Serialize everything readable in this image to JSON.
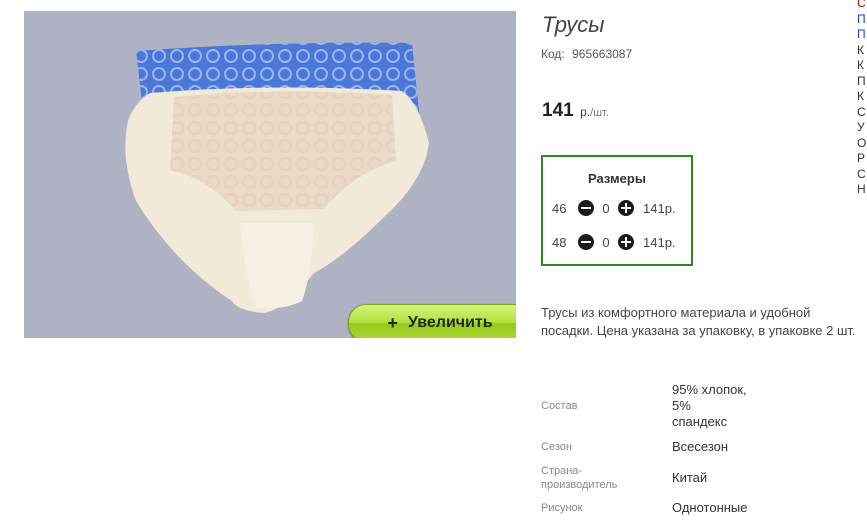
{
  "product": {
    "title": "Трусы",
    "code_label": "Код:",
    "code": "965663087",
    "price": "141",
    "currency": "р.",
    "per_unit": "/шт.",
    "zoom_button": "Увеличить",
    "zoom_icon": "plus-icon",
    "sizes_title": "Размеры",
    "sizes": [
      {
        "size": "46",
        "qty": "0",
        "price": "141р."
      },
      {
        "size": "48",
        "qty": "0",
        "price": "141р."
      }
    ],
    "description": "Трусы из комфортного материала и удобной посадки. Цена указана за упаковку, в упаковке 2 шт.",
    "attributes": [
      {
        "key": "Состав",
        "value": "95% хлопок,\n5%\nспандекс"
      },
      {
        "key": "Сезон",
        "value": "Всесезон"
      },
      {
        "key": "Страна-\nпроизводитель",
        "value": "Китай"
      },
      {
        "key": "Рисунок",
        "value": "Однотонные"
      }
    ]
  },
  "side_menu": {
    "items": [
      "С",
      "П",
      "П",
      "К",
      "К",
      "П",
      "К",
      "С",
      "У",
      "О",
      "Р",
      "С",
      "Н"
    ],
    "colors": [
      "#d00000",
      "#1a3cc0",
      "#1a3cc0",
      "#333333",
      "#333333",
      "#333333",
      "#333333",
      "#333333",
      "#333333",
      "#333333",
      "#333333",
      "#333333",
      "#333333"
    ]
  },
  "colors": {
    "accent_green": "#2e8b24",
    "button_green": "#b4e03e",
    "photo_bg": "#aeb2c3"
  }
}
